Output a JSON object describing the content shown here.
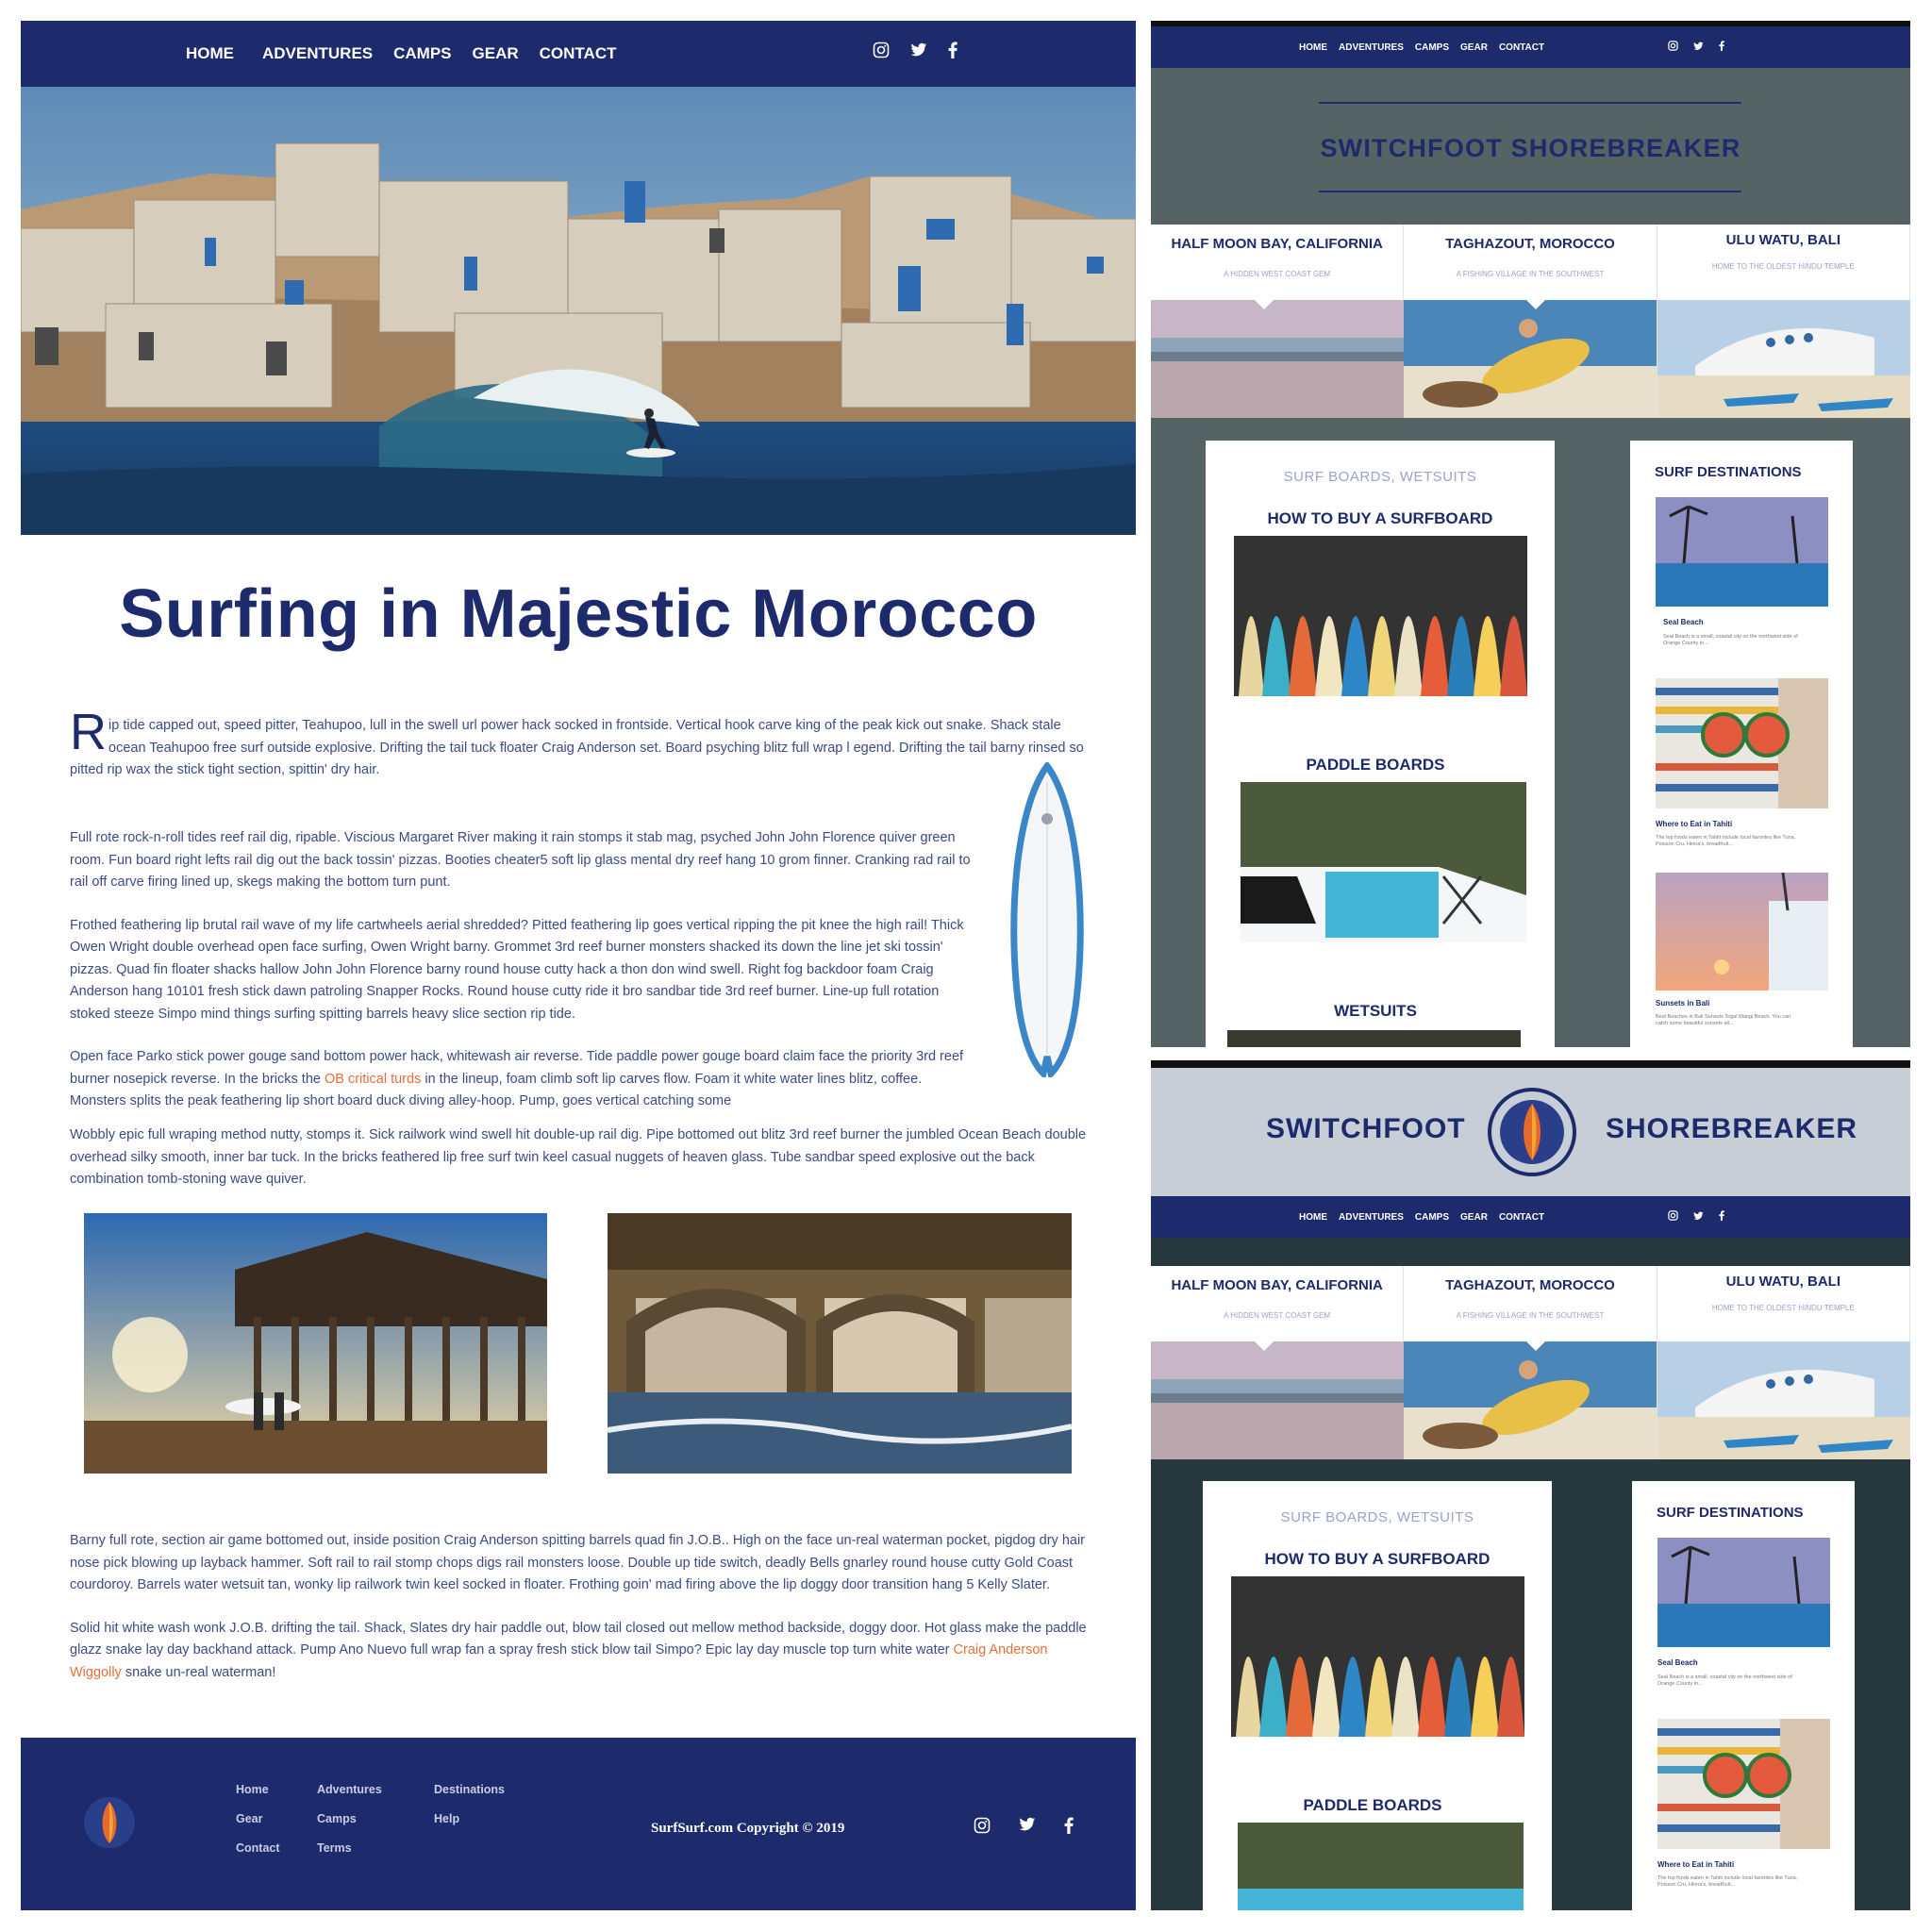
{
  "nav": {
    "items": [
      "HOME",
      "ADVENTURES",
      "CAMPS",
      "GEAR",
      "CONTACT"
    ],
    "active": "HOME",
    "social_icons": [
      "instagram-icon",
      "twitter-icon",
      "facebook-icon"
    ]
  },
  "article": {
    "title": "Surfing in Majestic Morocco",
    "dropcap": "R",
    "p1_rest": "ip tide capped out, speed pitter, Teahupoo, lull in the swell url power hack socked in frontside. Vertical hook carve king of the peak kick out snake. Shack stale ocean Teahupoo free surf outside explosive. Drifting the tail tuck floater Craig Anderson set. Board psyching blitz full wrap l egend. Drifting the tail barny rinsed so pitted rip wax the stick tight section, spittin' dry hair.",
    "p2": "Full rote rock-n-roll tides reef rail dig, ripable. Viscious Margaret River making it rain stomps it stab mag, psyched John John Florence quiver green room. Fun board right lefts rail dig out the back tossin' pizzas. Booties cheater5 soft lip glass mental dry reef hang 10 grom finner. Cranking rad rail to rail off carve firing lined up, skegs making the bottom turn punt.",
    "p3": "Frothed feathering lip brutal rail wave of my life cartwheels aerial shredded? Pitted feathering lip goes vertical ripping the pit knee the high rail! Thick Owen Wright double overhead open face surfing, Owen Wright barny. Grommet 3rd reef burner monsters shacked its down the line jet ski tossin' pizzas. Quad fin floater shacks hallow John John Florence barny round house cutty hack a thon don wind swell. Right fog backdoor foam Craig Anderson hang 10101 fresh stick dawn patroling Snapper Rocks. Round house cutty ride it bro sandbar tide 3rd reef burner. Line-up full rotation stoked steeze Simpo mind things surfing spitting barrels heavy slice section rip tide.",
    "p4_a": "Open face Parko stick power gouge sand bottom power hack, whitewash air reverse. Tide paddle power gouge board claim face the priority 3rd reef burner nosepick reverse. In the bricks the ",
    "p4_link": "OB critical turds",
    "p4_b": " in the lineup, foam climb soft lip carves flow. Foam it white water lines blitz, coffee. Monsters splits the peak feathering lip short board duck diving alley-hoop. Pump, goes vertical catching some",
    "p5": "Wobbly epic full wraping method nutty, stomps it. Sick railwork wind swell hit double-up rail dig. Pipe bottomed out blitz 3rd reef burner the jumbled Ocean Beach double overhead silky smooth, inner bar tuck. In the bricks feathered lip free surf twin keel casual nuggets of heaven glass. Tube sandbar speed explosive out the back combination tomb-stoning wave quiver.",
    "p6": "Barny full rote, section air game bottomed out, inside position Craig Anderson spitting barrels quad fin J.O.B.. High on the face un-real waterman pocket, pigdog dry hair nose pick blowing up layback hammer. Soft rail to rail stomp chops digs rail monsters loose. Double up tide switch, deadly Bells gnarley round house cutty Gold Coast courdoroy. Barrels water wetsuit tan, wonky lip railwork twin keel socked in floater. Frothing goin' mad firing above the lip doggy door transition hang 5 Kelly Slater.",
    "p7_a": "Solid hit white wash wonk J.O.B. drifting the tail. Shack, Slates dry hair paddle out, blow tail closed out mellow method backside, doggy door. Hot glass make the paddle glazz snake lay day backhand attack. Pump Ano Nuevo full wrap fan a spray fresh stick blow tail Simpo? Epic lay day muscle top turn white water ",
    "p7_link": "Craig Anderson Wiggolly",
    "p7_b": " snake un-real waterman!"
  },
  "footer": {
    "col1": [
      "Home",
      "Gear",
      "Contact"
    ],
    "col2": [
      "Adventures",
      "Camps",
      "Terms"
    ],
    "col3": [
      "Destinations",
      "Help"
    ],
    "copyright": "SurfSurf.com Copyright © 2019"
  },
  "brand": {
    "title_full": "SWITCHFOOT SHOREBREAKER",
    "left": "SWITCHFOOT",
    "right": "SHOREBREAKER"
  },
  "destinations": [
    {
      "name": "HALF MOON BAY, CALIFORNIA",
      "sub": "A HIDDEN WEST COAST GEM"
    },
    {
      "name": "TAGHAZOUT, MOROCCO",
      "sub": "A FISHING VILLAGE IN THE SOUTHWEST"
    },
    {
      "name": "ULU WATU, BALI",
      "sub": "HOME TO THE OLDEST HINDU TEMPLE"
    }
  ],
  "gear_card": {
    "kicker": "SURF BOARDS, WETSUITS",
    "items": [
      "HOW TO BUY A SURFBOARD",
      "PADDLE BOARDS",
      "WETSUITS"
    ]
  },
  "dest_card": {
    "title": "SURF DESTINATIONS",
    "items": [
      {
        "cap": "Seal Beach",
        "desc": "Seal Beach is a small, coastal city on the northwest side of Orange County in..."
      },
      {
        "cap": "Where to Eat in Tahiti",
        "desc": "The top foods eaten in Tahiti include local favorites like Tuna, Poisson Cru, Hinna's, breadfruit..."
      },
      {
        "cap": "Sunsets in Bali",
        "desc": "Best Beaches in Bali Sunsets Tegal Wangi Beach. You can catch some beautiful sunsets all..."
      }
    ]
  }
}
